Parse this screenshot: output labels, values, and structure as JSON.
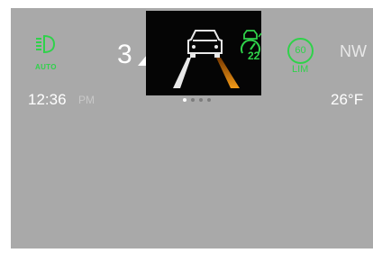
{
  "headlights": {
    "icon": "auto-headlight-icon",
    "label": "AUTO",
    "color": "#2fd24a"
  },
  "gear": {
    "value": "3",
    "shift_icon": "up-arrow-icon"
  },
  "driver_assist_popup": {
    "icon": "lane-keep-car-icon",
    "cruise_icon": "adaptive-cruise-icon",
    "cruise_value": "22",
    "page_count": 4,
    "active_page": 1
  },
  "speed_limit": {
    "value": "60",
    "label": "LIM",
    "color": "#2fd24a"
  },
  "compass": {
    "heading": "NW"
  },
  "clock": {
    "time": "12:36",
    "period": "PM"
  },
  "temperature": {
    "value": "26°F"
  }
}
